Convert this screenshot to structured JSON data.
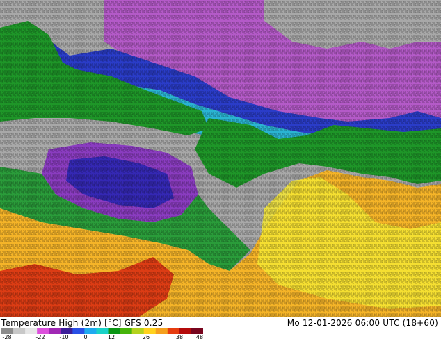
{
  "map": {
    "title": "Temperature High (2m) [°C] GFS 0.25",
    "datetime": "Mo 12-01-2026 06:00 UTC (18+60)"
  },
  "legend": {
    "ticks": [
      "-28",
      "-22",
      "-10",
      "0",
      "12",
      "26",
      "38",
      "48"
    ],
    "colors": [
      "#8c8c8c",
      "#c8c8c8",
      "#e6e6e6",
      "#dc50dc",
      "#a028b4",
      "#3c1e9a",
      "#2850e6",
      "#1eaaf0",
      "#19d2c8",
      "#0a9614",
      "#46b40a",
      "#b4d21e",
      "#ffd21e",
      "#f5a01e",
      "#e63c0f",
      "#b40a0a",
      "#78051e"
    ]
  },
  "regions": {
    "arctic_color": "#a0a0a0",
    "cold_color": "#b45ac8",
    "deepcold_color": "#2a3cc8",
    "cool_color": "#2ab4d2",
    "mild_color": "#1e9628",
    "warm_color": "#f5b428",
    "yellow_color": "#f5e632",
    "hot_color": "#dc3c14"
  }
}
